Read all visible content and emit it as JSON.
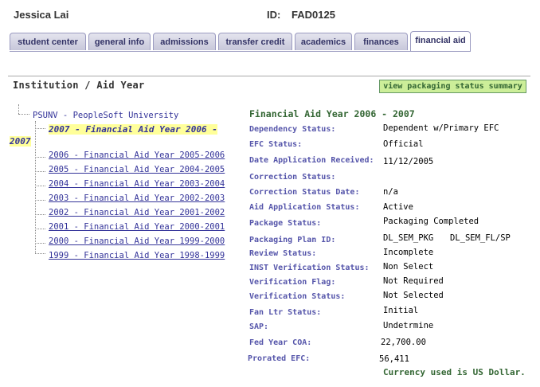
{
  "header": {
    "student_name": "Jessica Lai",
    "id_label": "ID:",
    "id_value": "FAD0125"
  },
  "tabs": [
    {
      "label": "student center"
    },
    {
      "label": "general info"
    },
    {
      "label": "admissions"
    },
    {
      "label": "transfer credit"
    },
    {
      "label": "academics"
    },
    {
      "label": "finances"
    },
    {
      "label": "financial aid",
      "active": true
    }
  ],
  "institution": {
    "title": "Institution / Aid Year",
    "button_label": "view packaging status summary"
  },
  "tree": {
    "root": "PSUNV - PeopleSoft University",
    "selected_line1": "2007 - Financial Aid Year 2006 -",
    "selected_line2": "2007",
    "items": [
      "2006 - Financial Aid Year 2005-2006",
      "2005 - Financial Aid Year 2004-2005",
      "2004 - Financial Aid Year 2003-2004",
      "2003 - Financial Aid Year 2002-2003",
      "2002 - Financial Aid Year 2001-2002",
      "2001 - Financial Aid Year 2000-2001",
      "2000 - Financial Aid Year 1999-2000",
      "1999 - Financial Aid Year 1998-1999"
    ]
  },
  "detail": {
    "title": "Financial Aid Year 2006 - 2007",
    "fields": [
      {
        "label": "Dependency Status:",
        "value": "Dependent w/Primary EFC"
      },
      {
        "label": "EFC Status:",
        "value": "Official"
      },
      {
        "label": "Date Application Received:",
        "value": "11/12/2005"
      },
      {
        "label": "Correction Status:",
        "value": ""
      },
      {
        "label": "Correction Status Date:",
        "value": "n/a"
      },
      {
        "label": "Aid Application Status:",
        "value": "Active"
      },
      {
        "label": "Package Status:",
        "value": "Packaging Completed"
      },
      {
        "label": "Packaging Plan ID:",
        "value": "DL_SEM_PKG",
        "value2": "DL_SEM_FL/SP"
      },
      {
        "label": "Review Status:",
        "value": "Incomplete"
      },
      {
        "label": "INST Verification Status:",
        "value": "Non Select"
      },
      {
        "label": "Verification Flag:",
        "value": "Not Required"
      },
      {
        "label": "Verification Status:",
        "value": "Not Selected"
      },
      {
        "label": "Fan Ltr Status:",
        "value": "Initial"
      },
      {
        "label": "SAP:",
        "value": "Undetrmine"
      },
      {
        "label": "Fed Year COA:",
        "value": "22,700.00"
      },
      {
        "label": "Prorated EFC:",
        "value": "56,411"
      }
    ],
    "currency_note": "Currency used is US Dollar."
  }
}
